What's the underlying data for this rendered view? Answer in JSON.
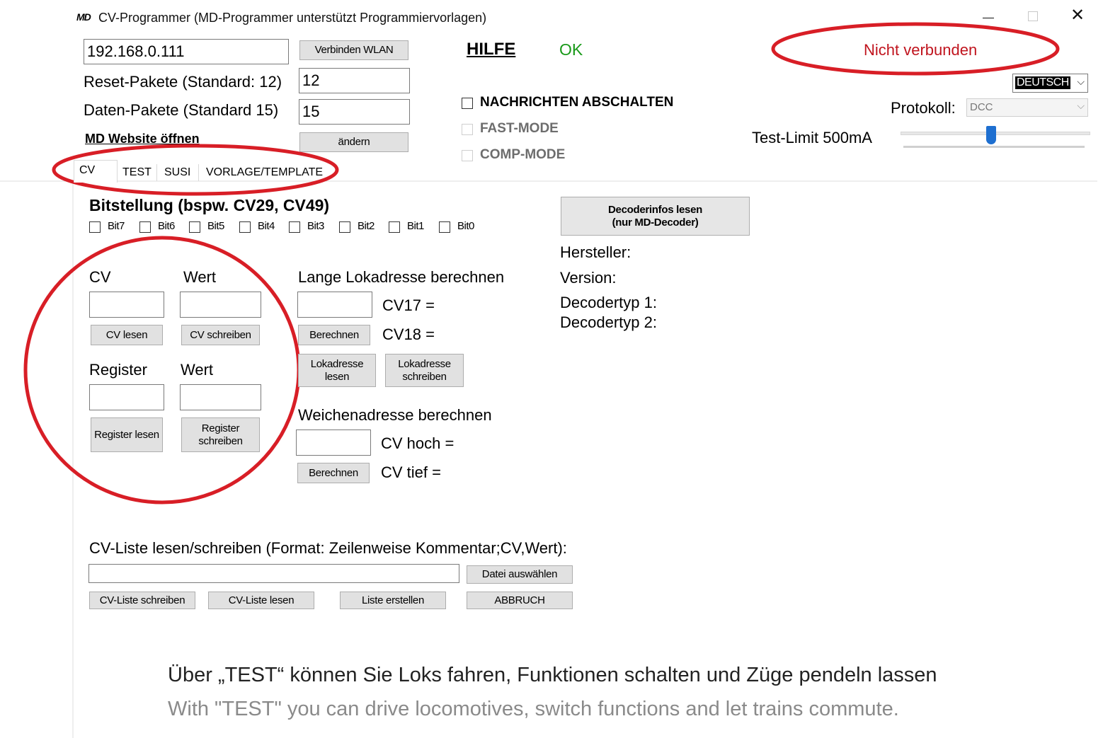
{
  "window": {
    "title": "CV-Programmer (MD-Programmer unterstützt Programmiervorlagen)",
    "logo": "MD"
  },
  "connection": {
    "ip_value": "192.168.0.111",
    "connect_label": "Verbinden WLAN",
    "help_label": "HILFE",
    "ok_label": "OK",
    "status": "Nicht verbunden"
  },
  "packets": {
    "reset_label": "Reset-Pakete (Standard: 12)",
    "reset_value": "12",
    "data_label": "Daten-Pakete (Standard 15)",
    "data_value": "15",
    "website_label": "MD Website öffnen",
    "change_label": "ändern"
  },
  "options": {
    "messages_off": "NACHRICHTEN ABSCHALTEN",
    "fast_mode": "FAST-MODE",
    "comp_mode": "COMP-MODE"
  },
  "settings": {
    "language": "DEUTSCH",
    "protocol_label": "Protokoll:",
    "protocol_value": "DCC",
    "test_limit_label": "Test-Limit 500mA",
    "test_limit_level": 0.48
  },
  "tabs": [
    {
      "label": "CV",
      "active": true
    },
    {
      "label": "TEST"
    },
    {
      "label": "SUSI"
    },
    {
      "label": "VORLAGE/TEMPLATE"
    }
  ],
  "bits": {
    "heading": "Bitstellung (bspw. CV29, CV49)",
    "labels": [
      "Bit7",
      "Bit6",
      "Bit5",
      "Bit4",
      "Bit3",
      "Bit2",
      "Bit1",
      "Bit0"
    ]
  },
  "cv": {
    "cv_label": "CV",
    "value_label": "Wert",
    "read_label": "CV lesen",
    "write_label": "CV schreiben",
    "register_label": "Register",
    "register_value_label": "Wert",
    "register_read_label": "Register lesen",
    "register_write_label": "Register schreiben"
  },
  "loco": {
    "heading": "Lange Lokadresse berechnen",
    "cv17_label": "CV17 =",
    "cv18_label": "CV18 =",
    "calc_label": "Berechnen",
    "read_label": "Lokadresse lesen",
    "write_label": "Lokadresse schreiben"
  },
  "turnout": {
    "heading": "Weichenadresse berechnen",
    "high_label": "CV hoch =",
    "low_label": "CV tief =",
    "calc_label": "Berechnen"
  },
  "decoder": {
    "button_line1": "Decoderinfos lesen",
    "button_line2": "(nur MD-Decoder)",
    "manufacturer": "Hersteller:",
    "version": "Version:",
    "type1": "Decodertyp 1:",
    "type2": "Decodertyp 2:"
  },
  "cvlist": {
    "heading": "CV-Liste lesen/schreiben (Format: Zeilenweise Kommentar;CV,Wert):",
    "file_value": "",
    "choose_file": "Datei auswählen",
    "write": "CV-Liste schreiben",
    "read": "CV-Liste lesen",
    "create": "Liste erstellen",
    "abort": "ABBRUCH"
  },
  "caption": {
    "german": "Über „TEST“ können Sie Loks fahren, Funktionen schalten und Züge pendeln lassen",
    "english": "With \"TEST\" you can drive locomotives, switch functions and let trains commute."
  },
  "colors": {
    "annotation_red": "#d81e26",
    "ok_green": "#1a9a1a",
    "status_red": "#c0141e",
    "slider_blue": "#1e6fd0"
  }
}
